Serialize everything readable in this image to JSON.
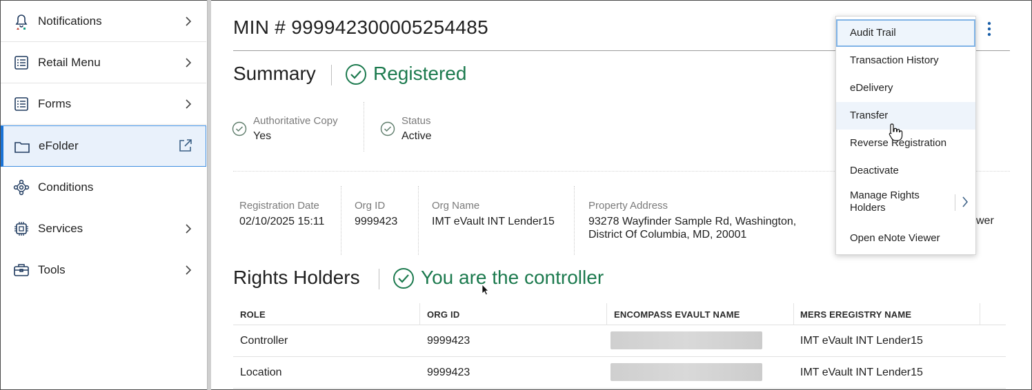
{
  "sidebar": {
    "items": [
      {
        "label": "Notifications",
        "icon": "bell-icon",
        "has_chevron": true
      },
      {
        "label": "Retail Menu",
        "icon": "list-icon",
        "has_chevron": true
      },
      {
        "label": "Forms",
        "icon": "list-icon",
        "has_chevron": true
      },
      {
        "label": "eFolder",
        "icon": "folder-icon",
        "active": true,
        "external": true
      },
      {
        "label": "Conditions",
        "icon": "network-icon",
        "has_chevron": false
      },
      {
        "label": "Services",
        "icon": "chip-icon",
        "has_chevron": true
      },
      {
        "label": "Tools",
        "icon": "toolbox-icon",
        "has_chevron": true
      }
    ]
  },
  "header": {
    "title": "MIN # 999942300005254485"
  },
  "summary": {
    "heading": "Summary",
    "status_text": "Registered",
    "authoritative_copy": {
      "label": "Authoritative Copy",
      "value": "Yes"
    },
    "status": {
      "label": "Status",
      "value": "Active"
    },
    "details": {
      "registration_date": {
        "label": "Registration Date",
        "value": "02/10/2025 15:11"
      },
      "org_id": {
        "label": "Org ID",
        "value": "9999423"
      },
      "org_name": {
        "label": "Org Name",
        "value": "IMT eVault INT Lender15"
      },
      "property_address": {
        "label": "Property Address",
        "line1": "93278 Wayfinder Sample Rd, Washington,",
        "line2": "District Of Columbia, MD, 20001"
      },
      "clipped_text": "wer"
    }
  },
  "rights_holders": {
    "heading": "Rights Holders",
    "status_text": "You are the controller",
    "columns": [
      "ROLE",
      "ORG ID",
      "ENCOMPASS EVAULT NAME",
      "MERS EREGISTRY NAME"
    ],
    "rows": [
      {
        "role": "Controller",
        "org_id": "9999423",
        "mers_name": "IMT eVault INT Lender15"
      },
      {
        "role": "Location",
        "org_id": "9999423",
        "mers_name": "IMT eVault INT Lender15"
      }
    ]
  },
  "actions_menu": {
    "items": [
      "Audit Trail",
      "Transaction History",
      "eDelivery",
      "Transfer",
      "Reverse Registration",
      "Deactivate",
      "Manage Rights Holders",
      "Open eNote Viewer"
    ],
    "focused": "Audit Trail",
    "hovered": "Transfer"
  },
  "colors": {
    "accent": "#1a73d6",
    "success": "#1c7a4e"
  }
}
